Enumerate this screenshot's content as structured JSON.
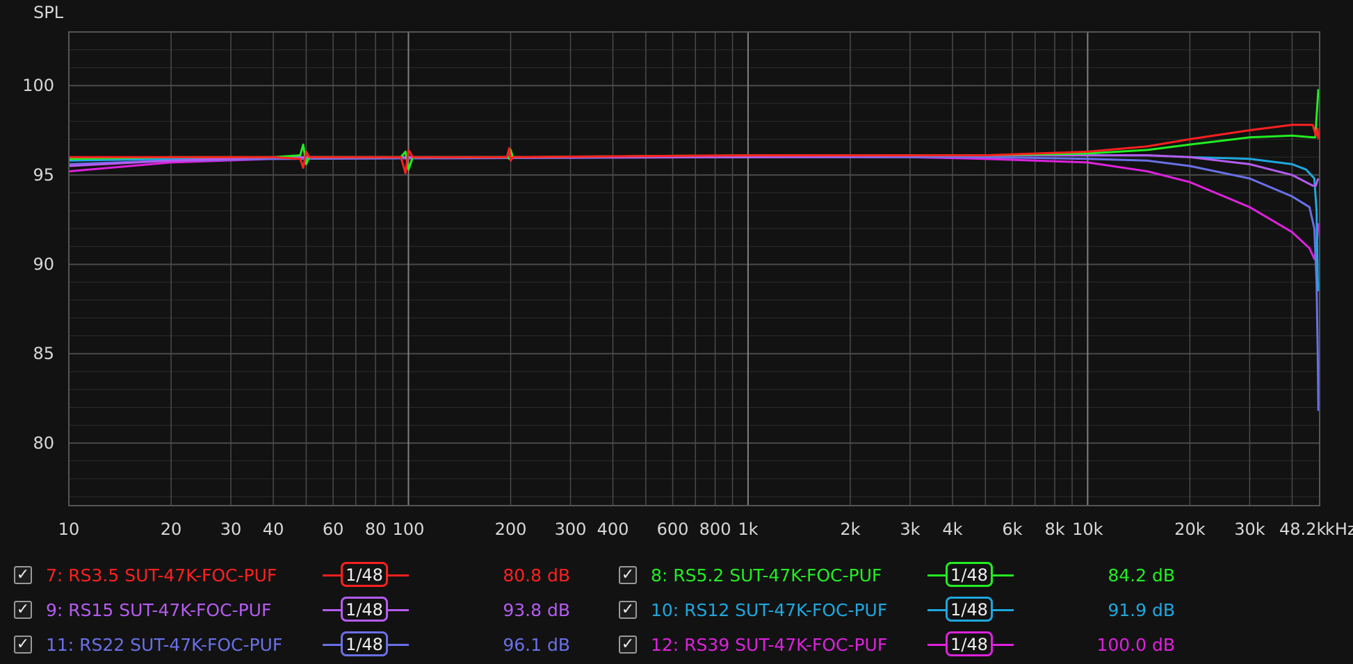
{
  "chart_data": {
    "type": "line",
    "ylabel": "SPL",
    "x_unit": "kHz",
    "xscale": "log",
    "xlim": [
      10,
      48200
    ],
    "ylim": [
      76.5,
      103
    ],
    "y_ticks": [
      80,
      85,
      90,
      95,
      100
    ],
    "x_tick_values": [
      10,
      20,
      30,
      40,
      60,
      80,
      100,
      200,
      300,
      400,
      600,
      800,
      1000,
      2000,
      3000,
      4000,
      6000,
      8000,
      10000,
      20000,
      30000,
      48200
    ],
    "x_tick_labels": [
      "10",
      "20",
      "30",
      "40",
      "60",
      "80",
      "100",
      "200",
      "300",
      "400",
      "600",
      "800",
      "1k",
      "2k",
      "3k",
      "4k",
      "6k",
      "8k",
      "10k",
      "20k",
      "30k",
      "48.2k"
    ],
    "grid": true,
    "legend_position": "bottom",
    "series": [
      {
        "name": "7: RS3.5 SUT-47K-FOC-PUF",
        "color": "#ff2020",
        "smoothing": "1/48",
        "value_label": "80.8 dB",
        "points": [
          [
            10,
            96.0
          ],
          [
            20,
            96.0
          ],
          [
            40,
            96.0
          ],
          [
            48,
            95.9
          ],
          [
            49,
            95.4
          ],
          [
            50,
            96.3
          ],
          [
            51,
            96.0
          ],
          [
            95,
            96.0
          ],
          [
            98,
            95.1
          ],
          [
            100,
            96.4
          ],
          [
            103,
            96.0
          ],
          [
            195,
            96.0
          ],
          [
            198,
            96.5
          ],
          [
            200,
            95.8
          ],
          [
            203,
            96.0
          ],
          [
            1000,
            96.1
          ],
          [
            5000,
            96.1
          ],
          [
            10000,
            96.3
          ],
          [
            15000,
            96.6
          ],
          [
            20000,
            97.0
          ],
          [
            30000,
            97.5
          ],
          [
            40000,
            97.8
          ],
          [
            46000,
            97.8
          ],
          [
            47000,
            97.2
          ],
          [
            47500,
            97.6
          ],
          [
            47800,
            97.0
          ]
        ]
      },
      {
        "name": "8: RS5.2 SUT-47K-FOC-PUF",
        "color": "#22ee22",
        "smoothing": "1/48",
        "value_label": "84.2 dB",
        "points": [
          [
            10,
            95.9
          ],
          [
            20,
            96.0
          ],
          [
            40,
            96.0
          ],
          [
            48,
            96.1
          ],
          [
            49,
            96.7
          ],
          [
            50,
            95.6
          ],
          [
            51,
            96.0
          ],
          [
            95,
            96.0
          ],
          [
            98,
            96.3
          ],
          [
            100,
            95.3
          ],
          [
            103,
            96.0
          ],
          [
            195,
            96.0
          ],
          [
            198,
            95.9
          ],
          [
            200,
            96.4
          ],
          [
            203,
            96.0
          ],
          [
            1000,
            96.1
          ],
          [
            5000,
            96.1
          ],
          [
            10000,
            96.2
          ],
          [
            15000,
            96.4
          ],
          [
            20000,
            96.7
          ],
          [
            30000,
            97.1
          ],
          [
            40000,
            97.2
          ],
          [
            46000,
            97.1
          ],
          [
            46800,
            97.1
          ],
          [
            47300,
            98.5
          ],
          [
            47800,
            99.8
          ]
        ]
      },
      {
        "name": "9: RS15 SUT-47K-FOC-PUF",
        "color": "#b55cf0",
        "smoothing": "1/48",
        "value_label": "93.8 dB",
        "points": [
          [
            10,
            95.5
          ],
          [
            20,
            95.8
          ],
          [
            40,
            96.0
          ],
          [
            1000,
            96.0
          ],
          [
            5000,
            96.1
          ],
          [
            10000,
            96.1
          ],
          [
            15000,
            96.1
          ],
          [
            20000,
            96.0
          ],
          [
            30000,
            95.6
          ],
          [
            40000,
            95.0
          ],
          [
            46000,
            94.4
          ],
          [
            47000,
            94.4
          ],
          [
            47500,
            94.7
          ],
          [
            47800,
            94.8
          ]
        ]
      },
      {
        "name": "10: RS12 SUT-47K-FOC-PUF",
        "color": "#1ea8df",
        "smoothing": "1/48",
        "value_label": "91.9 dB",
        "points": [
          [
            10,
            95.8
          ],
          [
            20,
            95.9
          ],
          [
            40,
            96.0
          ],
          [
            1000,
            96.0
          ],
          [
            5000,
            96.1
          ],
          [
            10000,
            96.1
          ],
          [
            15000,
            96.1
          ],
          [
            20000,
            96.0
          ],
          [
            30000,
            95.9
          ],
          [
            40000,
            95.6
          ],
          [
            44000,
            95.3
          ],
          [
            46500,
            94.8
          ],
          [
            47200,
            93.0
          ],
          [
            47600,
            89.0
          ],
          [
            47800,
            88.5
          ]
        ]
      },
      {
        "name": "11: RS22 SUT-47K-FOC-PUF",
        "color": "#6a70e8",
        "smoothing": "1/48",
        "value_label": "96.1 dB",
        "points": [
          [
            10,
            95.6
          ],
          [
            20,
            95.8
          ],
          [
            40,
            95.9
          ],
          [
            1000,
            96.0
          ],
          [
            5000,
            96.0
          ],
          [
            10000,
            95.9
          ],
          [
            15000,
            95.8
          ],
          [
            20000,
            95.5
          ],
          [
            30000,
            94.8
          ],
          [
            40000,
            93.8
          ],
          [
            45000,
            93.2
          ],
          [
            46500,
            92.0
          ],
          [
            47200,
            89.0
          ],
          [
            47600,
            85.0
          ],
          [
            47800,
            81.8
          ]
        ]
      },
      {
        "name": "12: RS39 SUT-47K-FOC-PUF",
        "color": "#dd22dd",
        "smoothing": "1/48",
        "value_label": "100.0 dB",
        "points": [
          [
            10,
            95.2
          ],
          [
            20,
            95.7
          ],
          [
            40,
            95.9
          ],
          [
            1000,
            96.0
          ],
          [
            3000,
            96.0
          ],
          [
            5000,
            95.9
          ],
          [
            10000,
            95.7
          ],
          [
            15000,
            95.2
          ],
          [
            20000,
            94.6
          ],
          [
            30000,
            93.2
          ],
          [
            40000,
            91.8
          ],
          [
            45000,
            90.9
          ],
          [
            46500,
            90.3
          ],
          [
            47200,
            91.0
          ],
          [
            47600,
            91.8
          ],
          [
            47800,
            92.3
          ]
        ]
      }
    ]
  }
}
